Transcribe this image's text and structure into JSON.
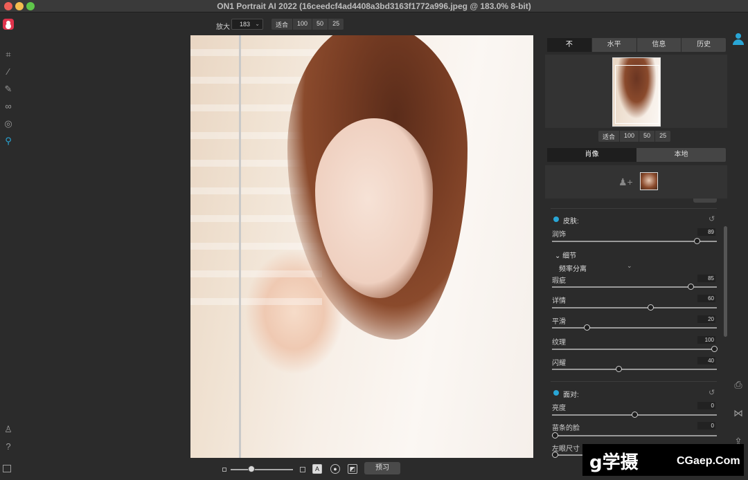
{
  "window": {
    "title": "ON1 Portrait AI 2022 (16ceedcf4ad4408a3bd3163f1772a996.jpeg @ 183.0% 8-bit)"
  },
  "toolbar": {
    "zoom_label": "放大",
    "zoom_value": "183",
    "zoom_presets": [
      "适合",
      "100",
      "50",
      "25"
    ]
  },
  "left_tools": [
    "crop-icon",
    "retouch-brush-icon",
    "adjustment-brush-icon",
    "blend-icon",
    "fingerprint-icon",
    "zoom-icon"
  ],
  "bottom_bar": {
    "preview_label": "预习"
  },
  "panel": {
    "nav_tabs": [
      "不",
      "水平",
      "信息",
      "历史"
    ],
    "nav_zoom_presets": [
      "适合",
      "100",
      "50",
      "25"
    ],
    "mode_tabs": [
      "肖像",
      "本地"
    ],
    "skin": {
      "title": "皮肤:",
      "sliders": [
        {
          "label": "润饰",
          "value": "89",
          "level": 0.89
        }
      ],
      "detail": {
        "title": "细节",
        "method": "频率分离",
        "sliders": [
          {
            "label": "瑕疵",
            "value": "85",
            "level": 0.85
          },
          {
            "label": "详情",
            "value": "60",
            "level": 0.6
          },
          {
            "label": "平滑",
            "value": "20",
            "level": 0.2
          },
          {
            "label": "纹理",
            "value": "100",
            "level": 1.0
          },
          {
            "label": "闪耀",
            "value": "40",
            "level": 0.4
          }
        ]
      }
    },
    "face": {
      "title": "面对:",
      "sliders": [
        {
          "label": "亮度",
          "value": "0",
          "level": 0.5
        },
        {
          "label": "苗条的脸",
          "value": "0",
          "level": 0.0
        },
        {
          "label": "左眼尺寸",
          "value": "",
          "level": 0.0
        }
      ]
    }
  },
  "watermark": {
    "logo": "g学摄",
    "site": "CGaep.Com"
  }
}
